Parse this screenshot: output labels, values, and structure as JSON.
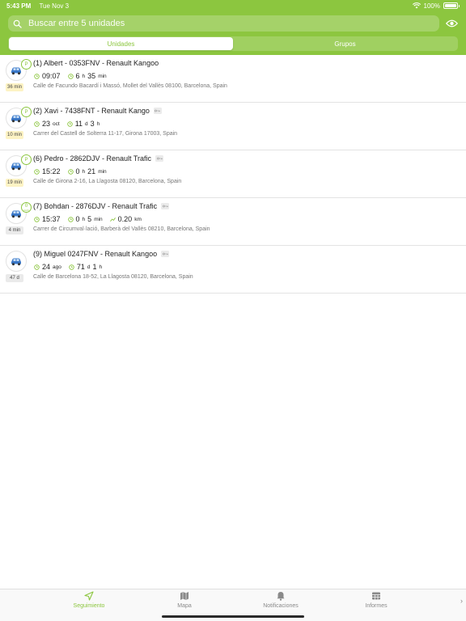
{
  "status_bar": {
    "time": "5:43 PM",
    "date": "Tue Nov 3",
    "battery": "100%"
  },
  "search": {
    "placeholder": "Buscar entre 5 unidades"
  },
  "segments": [
    {
      "label": "Unidades",
      "active": true
    },
    {
      "label": "Grupos",
      "active": false
    }
  ],
  "units": [
    {
      "badge": "P",
      "time_ago": "36 min",
      "badge_color": "yellow",
      "title": "(1) Albert - 0353FNV - Renault Kangoo",
      "key": false,
      "m1_value": "09:07",
      "m1_unit": "",
      "m2_a": "6",
      "m2_a_unit": "h",
      "m2_b": "35",
      "m2_b_unit": "min",
      "address": "Calle de Facundo Bacardí i Massó, Mollet del Vallès 08100, Barcelona, Spain"
    },
    {
      "badge": "P",
      "time_ago": "10 min",
      "badge_color": "yellow",
      "title": "(2) Xavi - 7438FNT - Renault Kango",
      "key": true,
      "m1_value": "23",
      "m1_unit": "oct",
      "m2_a": "11",
      "m2_a_unit": "d",
      "m2_b": "3",
      "m2_b_unit": "h",
      "address": "Carrer del Castell de Solterra 11-17, Girona 17003, Spain"
    },
    {
      "badge": "P",
      "time_ago": "19 min",
      "badge_color": "yellow",
      "title": "(6) Pedro - 2862DJV - Renault Trafic",
      "key": true,
      "m1_value": "15:22",
      "m1_unit": "",
      "m2_a": "0",
      "m2_a_unit": "h",
      "m2_b": "21",
      "m2_b_unit": "min",
      "address": "Calle de Girona 2-16, La Llagosta 08120, Barcelona, Spain"
    },
    {
      "badge": "0",
      "badge_sub": "km/h",
      "time_ago": "4 min",
      "badge_color": "gray",
      "title": "(7) Bohdan - 2876DJV - Renault Trafic",
      "key": true,
      "m1_value": "15:37",
      "m1_unit": "",
      "m2_a": "0",
      "m2_a_unit": "h",
      "m2_b": "5",
      "m2_b_unit": "min",
      "m3_value": "0.20",
      "m3_unit": "km",
      "address": "Carrer de Circumval·lació, Barberà del Vallès 08210, Barcelona, Spain"
    },
    {
      "badge": "",
      "time_ago": "47 d",
      "badge_color": "gray",
      "title": "(9) Miguel 0247FNV - Renault Kangoo",
      "key": true,
      "m1_value": "24",
      "m1_unit": "ago",
      "m2_a": "71",
      "m2_a_unit": "d",
      "m2_b": "1",
      "m2_b_unit": "h",
      "address": "Calle de Barcelona 18-52, La Llagosta 08120, Barcelona, Spain"
    }
  ],
  "tabs": [
    {
      "label": "Seguimiento",
      "icon": "navigation-arrow-icon",
      "active": true
    },
    {
      "label": "Mapa",
      "icon": "map-icon",
      "active": false
    },
    {
      "label": "Notificaciones",
      "icon": "bell-icon",
      "active": false
    },
    {
      "label": "Informes",
      "icon": "table-icon",
      "active": false
    }
  ],
  "colors": {
    "accent": "#8cc63f",
    "pending_badge": "#fdf3c4"
  }
}
